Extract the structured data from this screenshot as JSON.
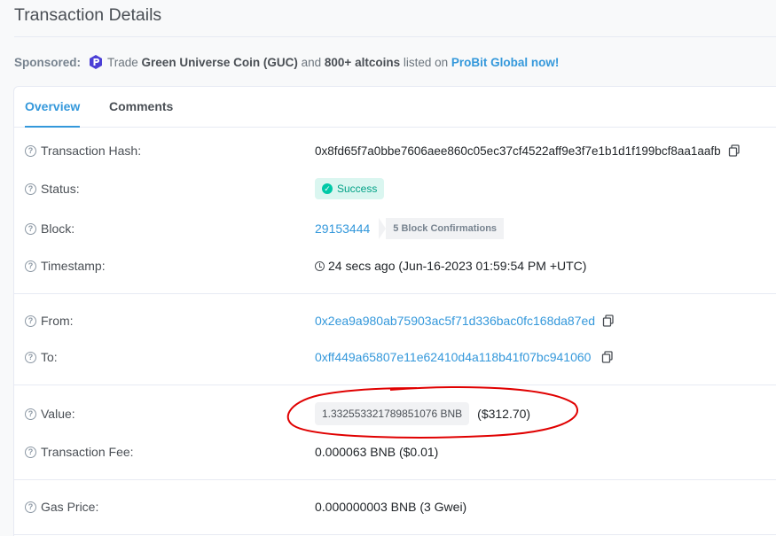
{
  "page": {
    "title": "Transaction Details"
  },
  "sponsored": {
    "label": "Sponsored:",
    "text_trade": "Trade",
    "coin": "Green Universe Coin (GUC)",
    "text_and": "and",
    "altcoins": "800+ altcoins",
    "text_listed": "listed on",
    "link": "ProBit Global now!"
  },
  "tabs": [
    {
      "label": "Overview",
      "active": true
    },
    {
      "label": "Comments",
      "active": false
    }
  ],
  "details": {
    "tx_hash": {
      "label": "Transaction Hash:",
      "value": "0x8fd65f7a0bbe7606aee860c05ec37cf4522aff9e3f7e1b1d1f199bcf8aa1aafb"
    },
    "status": {
      "label": "Status:",
      "value": "Success"
    },
    "block": {
      "label": "Block:",
      "value": "29153444",
      "confirmations": "5 Block Confirmations"
    },
    "timestamp": {
      "label": "Timestamp:",
      "value": "24 secs ago (Jun-16-2023 01:59:54 PM +UTC)"
    },
    "from": {
      "label": "From:",
      "value": "0x2ea9a980ab75903ac5f71d336bac0fc168da87ed"
    },
    "to": {
      "label": "To:",
      "value": "0xff449a65807e11e62410d4a118b41f07bc941060"
    },
    "value": {
      "label": "Value:",
      "amount": "1.332553321789851076 BNB",
      "usd": "($312.70)"
    },
    "fee": {
      "label": "Transaction Fee:",
      "value": "0.000063 BNB ($0.01)"
    },
    "gas_price": {
      "label": "Gas Price:",
      "value": "0.000000003 BNB (3 Gwei)"
    }
  },
  "colors": {
    "link": "#3498db",
    "success": "#00a186",
    "annotation": "#e00000"
  }
}
